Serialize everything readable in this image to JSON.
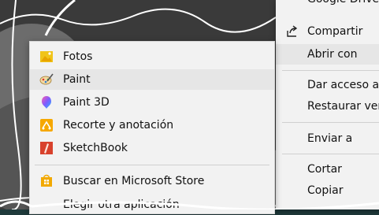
{
  "context_menu": {
    "partial_top": "Google Drive",
    "items": [
      {
        "label": "Compartir",
        "icon": "share-icon"
      },
      {
        "label": "Abrir con"
      },
      {
        "label": "Dar acceso a"
      },
      {
        "label": "Restaurar vers"
      },
      {
        "label": "Enviar a"
      },
      {
        "label": "Cortar"
      },
      {
        "label": "Copiar"
      }
    ]
  },
  "submenu": {
    "items": [
      {
        "label": "Fotos",
        "icon": "photos-icon"
      },
      {
        "label": "Paint",
        "icon": "paint-icon"
      },
      {
        "label": "Paint 3D",
        "icon": "paint-3d-icon"
      },
      {
        "label": "Recorte y anotación",
        "icon": "snip-sketch-icon"
      },
      {
        "label": "SketchBook",
        "icon": "sketchbook-icon"
      },
      {
        "label": "Buscar en Microsoft Store",
        "icon": "store-icon"
      },
      {
        "label": "Elegir otra aplicación"
      }
    ]
  }
}
